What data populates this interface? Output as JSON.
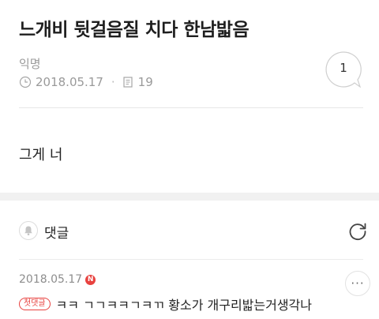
{
  "post": {
    "title": "느개비 뒷걸음질 치다 한남밟음",
    "author": "익명",
    "date": "2018.05.17",
    "views": "19",
    "comment_count": "1",
    "body": "그게 너"
  },
  "comments": {
    "header_label": "댓글",
    "items": [
      {
        "date": "2018.05.17",
        "new_badge": "N",
        "first_tag": "첫댓글",
        "text": "ㅋㅋ ㄱㄱㅋㅋㄱㅋㄲ 황소가 개구리밟는거생각나",
        "more_label": "···"
      }
    ]
  },
  "icons": {
    "clock": "clock-icon",
    "views": "document-icon",
    "bell": "bell-icon",
    "refresh": "refresh-icon",
    "speech": "speech-bubble-icon"
  },
  "colors": {
    "accent_red": "#e8423f",
    "meta_gray": "#9a9a9a",
    "divider": "#e6e6e6"
  }
}
